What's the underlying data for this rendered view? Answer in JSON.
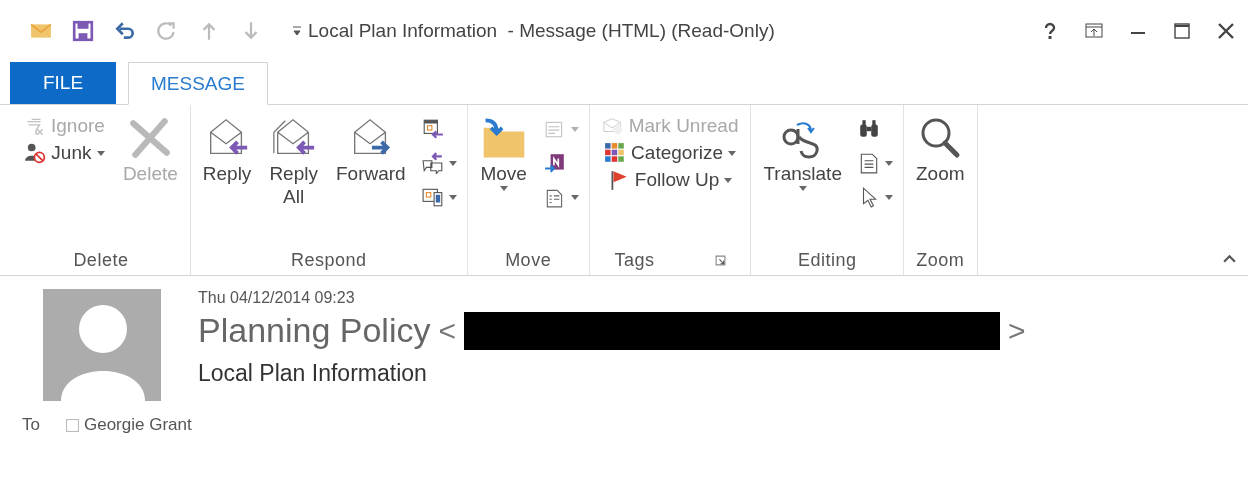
{
  "window": {
    "title": "Local Plan Information  - Message (HTML) (Read-Only)"
  },
  "tabs": [
    {
      "label": "FILE",
      "kind": "backstage",
      "selected": false
    },
    {
      "label": "MESSAGE",
      "kind": "tab",
      "selected": true
    }
  ],
  "ribbon": {
    "groups": [
      {
        "label": "Delete",
        "launcher": false,
        "columns": [
          [
            {
              "kind": "small",
              "label": "Ignore",
              "disabled": true,
              "dropdown": false
            },
            {
              "kind": "small",
              "label": "Junk",
              "disabled": false,
              "dropdown": true
            }
          ],
          [
            {
              "kind": "large",
              "label": "Delete",
              "disabled": true,
              "dropdown": false
            }
          ]
        ]
      },
      {
        "label": "Respond",
        "launcher": false,
        "columns": [
          [
            {
              "kind": "large",
              "label": "Reply",
              "disabled": false,
              "dropdown": false
            }
          ],
          [
            {
              "kind": "large",
              "label": "Reply All",
              "disabled": false,
              "dropdown": false
            }
          ],
          [
            {
              "kind": "large",
              "label": "Forward",
              "disabled": false,
              "dropdown": false
            }
          ],
          [
            {
              "kind": "icon",
              "disabled": false,
              "dropdown": false
            },
            {
              "kind": "icon",
              "disabled": false,
              "dropdown": true
            },
            {
              "kind": "icon",
              "disabled": false,
              "dropdown": true
            }
          ]
        ]
      },
      {
        "label": "Move",
        "launcher": false,
        "columns": [
          [
            {
              "kind": "large",
              "label": "Move",
              "disabled": false,
              "dropdown": true
            }
          ],
          [
            {
              "kind": "icon",
              "disabled": true,
              "dropdown": true
            },
            {
              "kind": "icon",
              "disabled": false,
              "dropdown": false
            },
            {
              "kind": "icon",
              "disabled": false,
              "dropdown": true
            }
          ]
        ]
      },
      {
        "label": "Tags",
        "launcher": true,
        "columns": [
          [
            {
              "kind": "small",
              "label": "Mark Unread",
              "disabled": true,
              "dropdown": false
            },
            {
              "kind": "small",
              "label": "Categorize",
              "disabled": false,
              "dropdown": true
            },
            {
              "kind": "small",
              "label": "Follow Up",
              "disabled": false,
              "dropdown": true
            }
          ]
        ]
      },
      {
        "label": "Editing",
        "launcher": false,
        "columns": [
          [
            {
              "kind": "large",
              "label": "Translate",
              "disabled": false,
              "dropdown": true
            }
          ],
          [
            {
              "kind": "icon",
              "disabled": false,
              "dropdown": false
            },
            {
              "kind": "icon",
              "disabled": false,
              "dropdown": true
            },
            {
              "kind": "icon",
              "disabled": false,
              "dropdown": true
            }
          ]
        ]
      },
      {
        "label": "Zoom",
        "launcher": false,
        "columns": [
          [
            {
              "kind": "large",
              "label": "Zoom",
              "disabled": false,
              "dropdown": false
            }
          ]
        ]
      }
    ]
  },
  "message": {
    "date": "Thu 04/12/2014 09:23",
    "sender_name": "Planning Policy",
    "sender_open": "<",
    "sender_address_redacted": true,
    "sender_close": ">",
    "subject": "Local Plan Information",
    "to_label": "To",
    "recipients": [
      "Georgie Grant"
    ]
  }
}
